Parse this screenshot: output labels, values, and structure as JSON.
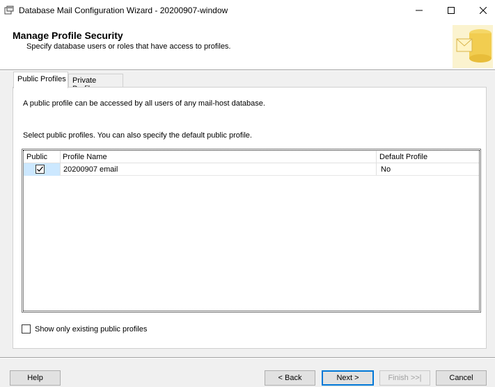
{
  "window": {
    "title": "Database Mail Configuration Wizard - 20200907-window",
    "icons": [
      "app-icon",
      "minimize-icon",
      "maximize-icon",
      "close-icon"
    ]
  },
  "header": {
    "title": "Manage Profile Security",
    "subtitle": "Specify database users or roles that have access to profiles.",
    "icon": "database-mail-icon"
  },
  "tabs": [
    {
      "label": "Public Profiles",
      "selected": true
    },
    {
      "label": "Private Profiles",
      "selected": false
    }
  ],
  "panel": {
    "description": "A public profile can be accessed by all users of any mail-host database.",
    "instruction": "Select public profiles. You can also specify the default public profile."
  },
  "grid": {
    "columns": [
      "Public",
      "Profile Name",
      "Default Profile"
    ],
    "rows": [
      {
        "public": true,
        "profile_name": "20200907 email",
        "default_profile": "No"
      }
    ]
  },
  "show_only": {
    "label": "Show only existing public profiles",
    "checked": false
  },
  "buttons": {
    "help": "Help",
    "back": "< Back",
    "next": "Next >",
    "finish": "Finish >>|",
    "cancel": "Cancel"
  },
  "colors": {
    "accent": "#0078d7",
    "selection": "#cce8ff"
  }
}
